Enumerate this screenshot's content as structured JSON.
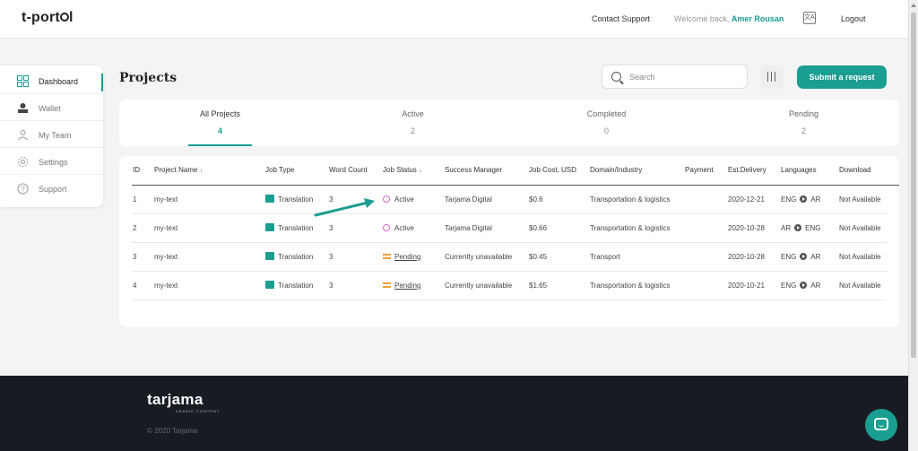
{
  "header": {
    "logo": "t-portal",
    "contact_support": "Contact Support",
    "welcome_prefix": "Welcome back,",
    "user_name": "Amer Rousan",
    "logout": "Logout",
    "translate_icon": "translate-icon"
  },
  "sidebar": {
    "items": [
      {
        "label": "Dashboard",
        "icon": "dashboard-icon",
        "active": true
      },
      {
        "label": "Wallet",
        "icon": "wallet-icon"
      },
      {
        "label": "My Team",
        "icon": "team-icon"
      },
      {
        "label": "Settings",
        "icon": "gear-icon"
      },
      {
        "label": "Support",
        "icon": "help-icon"
      }
    ]
  },
  "main": {
    "title": "Projects",
    "search": {
      "placeholder": "Search"
    },
    "submit_label": "Submit a request",
    "tabs": [
      {
        "label": "All Projects",
        "count": "4",
        "active": true
      },
      {
        "label": "Active",
        "count": "2"
      },
      {
        "label": "Completed",
        "count": "0"
      },
      {
        "label": "Pending",
        "count": "2"
      }
    ]
  },
  "table": {
    "columns": [
      "ID",
      "Project Name",
      "Job Type",
      "Word Count",
      "Job Status",
      "Success Manager",
      "Job Cost, USD",
      "Domain/Industry",
      "Payment",
      "Est.Delivery",
      "Languages",
      "Download"
    ],
    "rows": [
      {
        "id": "1",
        "name": "my-text",
        "job_type": "Translation",
        "words": "3",
        "status": "Active",
        "manager": "Tarjama Digital",
        "cost": "$0.6",
        "domain": "Transportation & logistics",
        "payment": "",
        "delivery": "2020-12-21",
        "lang_from": "ENG",
        "lang_to": "AR",
        "download": "Not Available"
      },
      {
        "id": "2",
        "name": "my-text",
        "job_type": "Translation",
        "words": "3",
        "status": "Active",
        "manager": "Tarjama Digital",
        "cost": "$0.66",
        "domain": "Transportation & logistics",
        "payment": "",
        "delivery": "2020-10-28",
        "lang_from": "AR",
        "lang_to": "ENG",
        "download": "Not Available"
      },
      {
        "id": "3",
        "name": "my-text",
        "job_type": "Translation",
        "words": "3",
        "status": "Pending",
        "manager": "Currently unavailable",
        "cost": "$0.45",
        "domain": "Transport",
        "payment": "",
        "delivery": "2020-10-28",
        "lang_from": "ENG",
        "lang_to": "AR",
        "download": "Not Available"
      },
      {
        "id": "4",
        "name": "my-text",
        "job_type": "Translation",
        "words": "3",
        "status": "Pending",
        "manager": "Currently unavailable",
        "cost": "$1.65",
        "domain": "Transportation & logistics",
        "payment": "",
        "delivery": "2020-10-21",
        "lang_from": "ENG",
        "lang_to": "AR",
        "download": "Not Available"
      }
    ]
  },
  "footer": {
    "logo": "tarjama",
    "logo_sub": "ARABIC CONTENT",
    "copyright": "© 2020 Tarjama"
  },
  "colors": {
    "accent": "#1a9e91",
    "active_status": "#d86bc9",
    "pending_status": "#e8a23a"
  }
}
